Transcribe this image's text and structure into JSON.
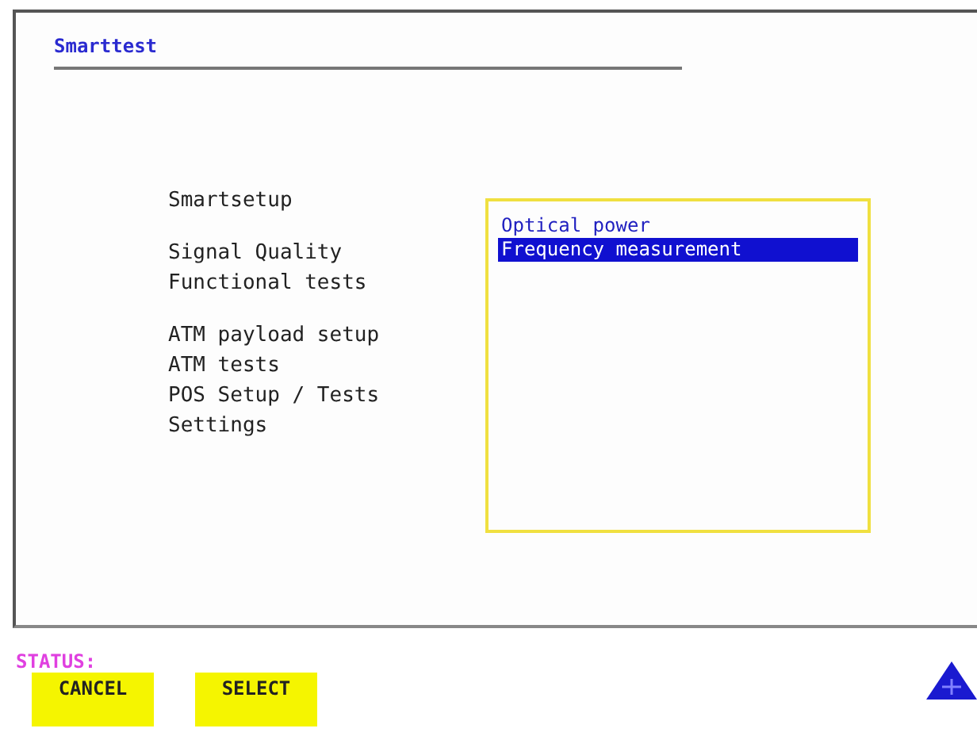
{
  "screen": {
    "title": "Smarttest"
  },
  "menu_groups": [
    [
      "Smartsetup"
    ],
    [
      "Signal Quality",
      "Functional tests"
    ],
    [
      "ATM payload setup",
      "ATM tests",
      "POS Setup / Tests",
      "Settings"
    ]
  ],
  "list": [
    {
      "label": "Optical power",
      "selected": false
    },
    {
      "label": "Frequency measurement",
      "selected": true
    }
  ],
  "status": {
    "label": "STATUS:"
  },
  "softkeys": [
    "CANCEL",
    "SELECT"
  ]
}
